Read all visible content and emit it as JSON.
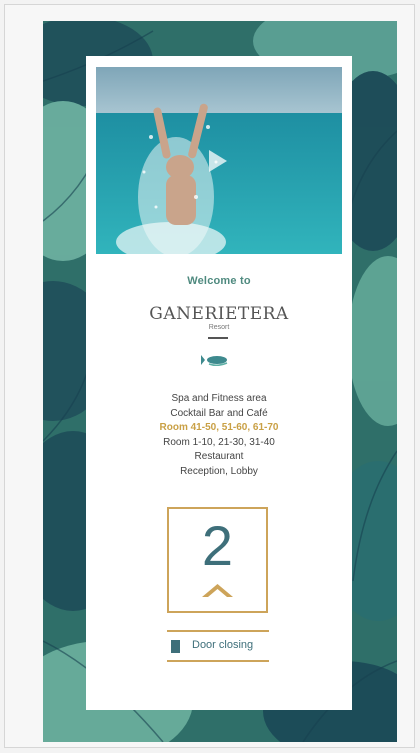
{
  "welcome": "Welcome to",
  "hotel": {
    "name": "GANERIETERA",
    "tagline": "Resort"
  },
  "floors": [
    "Spa and Fitness area",
    "Cocktail Bar and Café",
    "Room 41-50, 51-60, 61-70",
    "Room 1-10, 21-30, 31-40",
    "Restaurant",
    "Reception, Lobby"
  ],
  "active_floor_index": 2,
  "elevator": {
    "floor": "2",
    "direction": "up"
  },
  "door_status": "Door closing",
  "colors": {
    "accent_gold": "#cda45a",
    "active_text": "#c9a045",
    "teal_text": "#3e6f7a",
    "welcome_green": "#4f8a7f",
    "leaf_background": "#2b6f68"
  },
  "icons": {
    "video": "play-icon",
    "logo": "fish-icon",
    "direction": "arrow-up-icon",
    "door": "door-icon"
  }
}
